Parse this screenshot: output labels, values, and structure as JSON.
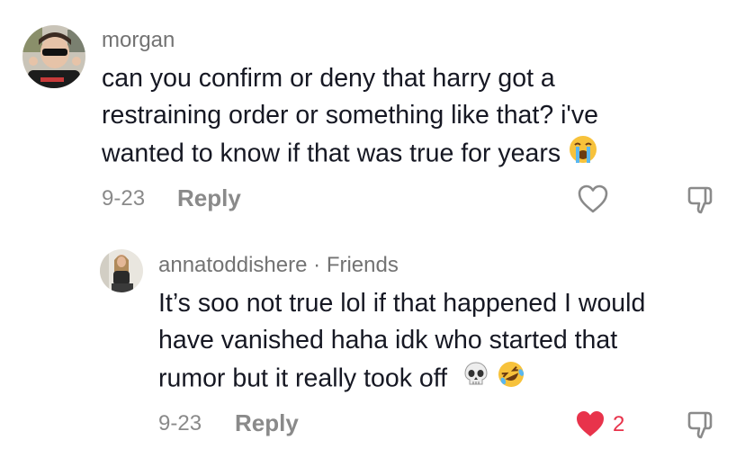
{
  "comment": {
    "username": "morgan",
    "lines": [
      "can you confirm or deny that harry got a",
      "restraining order or something like that? i've",
      "wanted to know if that was true for years"
    ],
    "emoji": "loudly-crying-face",
    "date": "9-23",
    "reply_label": "Reply",
    "like_icon": "heart-outline-icon",
    "dislike_icon": "thumbs-down-icon"
  },
  "reply": {
    "username": "annatoddishere",
    "separator": "·",
    "badge": "Friends",
    "lines": [
      "It’s soo not true lol if that happened I would",
      "have vanished haha idk who started that",
      "rumor but it really took off"
    ],
    "emojis": [
      "skull",
      "rolling-on-floor-laughing"
    ],
    "date": "9-23",
    "reply_label": "Reply",
    "like_icon": "heart-filled-icon",
    "like_count": "2",
    "dislike_icon": "thumbs-down-icon"
  },
  "colors": {
    "text": "#161823",
    "muted": "#737373",
    "liked": "#e8334b"
  }
}
